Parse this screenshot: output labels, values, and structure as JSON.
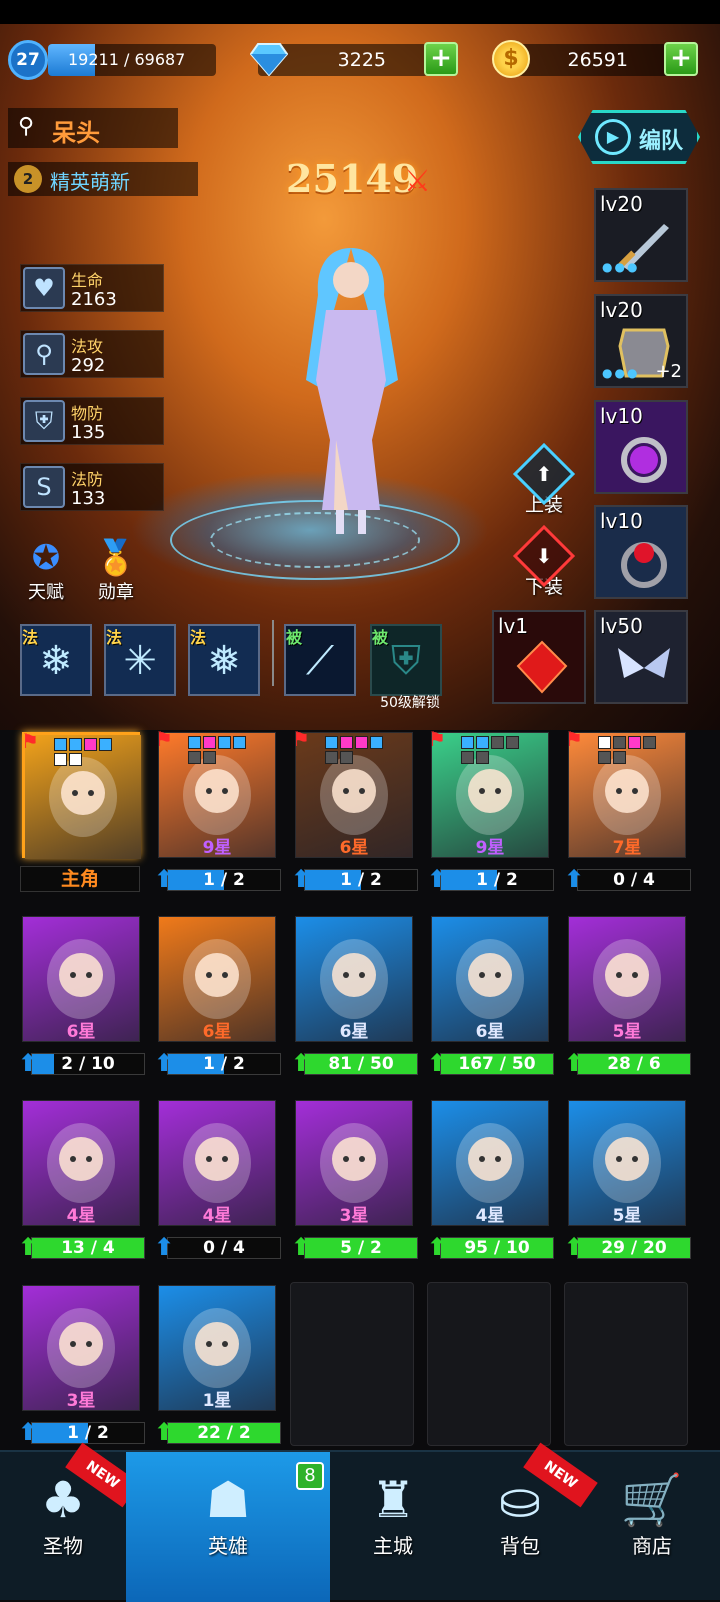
{
  "player": {
    "level": "27",
    "xp": "19211 / 69687",
    "xp_fraction": 0.276,
    "gems": "3225",
    "gold": "26591",
    "name": "呆头",
    "rank": "精英萌新",
    "rank_badge": "2",
    "power": "25149",
    "team_button": "编队"
  },
  "stats": [
    {
      "label": "生命",
      "value": "2163",
      "icon": "heart-icon"
    },
    {
      "label": "法攻",
      "value": "292",
      "icon": "wand-icon"
    },
    {
      "label": "物防",
      "value": "135",
      "icon": "shield-icon"
    },
    {
      "label": "法防",
      "value": "133",
      "icon": "magic-shield-icon"
    }
  ],
  "equipment": [
    {
      "level": "lv20",
      "icon": "sword-icon",
      "dots": "●●●",
      "plus": ""
    },
    {
      "level": "lv20",
      "icon": "armor-icon",
      "dots": "●●●",
      "plus": "+2"
    },
    {
      "level": "lv10",
      "icon": "purple-ring-icon",
      "dots": "",
      "plus": ""
    },
    {
      "level": "lv10",
      "icon": "red-ring-icon",
      "dots": "",
      "plus": ""
    },
    {
      "level": "lv1",
      "icon": "red-gem-icon",
      "dots": "",
      "plus": ""
    },
    {
      "level": "lv50",
      "icon": "wings-icon",
      "dots": "",
      "plus": ""
    }
  ],
  "actions": {
    "equip_on": "上装",
    "equip_off": "下装",
    "talent": "天赋",
    "medal": "勋章"
  },
  "skills": [
    {
      "tag": "法",
      "icon": "ice-crystal-icon"
    },
    {
      "tag": "法",
      "icon": "snowflake-burst-icon"
    },
    {
      "tag": "法",
      "icon": "blizzard-icon"
    },
    {
      "tag": "被",
      "icon": "ice-blade-icon"
    },
    {
      "tag": "被",
      "icon": "locked-shield-icon",
      "lock_text": "50级解锁"
    }
  ],
  "heroes": [
    {
      "star": "",
      "progress": "",
      "main": true,
      "main_label": "主角",
      "bg": "#f2a21a",
      "arrow": "",
      "fill_color": ""
    },
    {
      "star": "9星",
      "progress": "1 / 2",
      "bg": "#ff7a2a",
      "arrow": "blue",
      "fill_color": "#1c8ee8",
      "fill": 0.5
    },
    {
      "star": "6星",
      "progress": "1 / 2",
      "bg": "#6b3a1a",
      "arrow": "blue",
      "fill_color": "#1c8ee8",
      "fill": 0.5
    },
    {
      "star": "9星",
      "progress": "1 / 2",
      "bg": "#3ad08a",
      "arrow": "blue",
      "fill_color": "#1c8ee8",
      "fill": 0.5
    },
    {
      "star": "7星",
      "progress": "0 / 4",
      "bg": "#ff8a3a",
      "arrow": "blue",
      "fill_color": "#1c8ee8",
      "fill": 0.0
    },
    {
      "star": "6星",
      "progress": "2 / 10",
      "bg": "#a32ed8",
      "arrow": "blue",
      "fill_color": "#1c8ee8",
      "fill": 0.2
    },
    {
      "star": "6星",
      "progress": "1 / 2",
      "bg": "#f07a1a",
      "arrow": "blue",
      "fill_color": "#1c8ee8",
      "fill": 0.5
    },
    {
      "star": "6星",
      "progress": "81 / 50",
      "bg": "#1c8ee8",
      "arrow": "green",
      "fill_color": "#2ed82e",
      "fill": 1.0
    },
    {
      "star": "6星",
      "progress": "167 / 50",
      "bg": "#1c8ee8",
      "arrow": "green",
      "fill_color": "#2ed82e",
      "fill": 1.0
    },
    {
      "star": "5星",
      "progress": "28 / 6",
      "bg": "#a32ed8",
      "arrow": "green",
      "fill_color": "#2ed82e",
      "fill": 1.0
    },
    {
      "star": "4星",
      "progress": "13 / 4",
      "bg": "#a32ed8",
      "arrow": "green",
      "fill_color": "#2ed82e",
      "fill": 1.0
    },
    {
      "star": "4星",
      "progress": "0 / 4",
      "bg": "#a32ed8",
      "arrow": "blue",
      "fill_color": "#1c8ee8",
      "fill": 0.0
    },
    {
      "star": "3星",
      "progress": "5 / 2",
      "bg": "#a32ed8",
      "arrow": "green",
      "fill_color": "#2ed82e",
      "fill": 1.0
    },
    {
      "star": "4星",
      "progress": "95 / 10",
      "bg": "#1c8ee8",
      "arrow": "green",
      "fill_color": "#2ed82e",
      "fill": 1.0
    },
    {
      "star": "5星",
      "progress": "29 / 20",
      "bg": "#1c8ee8",
      "arrow": "green",
      "fill_color": "#2ed82e",
      "fill": 1.0
    },
    {
      "star": "3星",
      "progress": "1 / 2",
      "bg": "#a32ed8",
      "arrow": "blue",
      "fill_color": "#1c8ee8",
      "fill": 0.5
    },
    {
      "star": "1星",
      "progress": "22 / 2",
      "bg": "#1c8ee8",
      "arrow": "green",
      "fill_color": "#2ed82e",
      "fill": 1.0
    }
  ],
  "nav": [
    {
      "label": "圣物",
      "icon": "clover-icon",
      "badge": "NEW"
    },
    {
      "label": "英雄",
      "icon": "hero-helmet-icon",
      "count": "8",
      "active": true
    },
    {
      "label": "主城",
      "icon": "castle-icon"
    },
    {
      "label": "背包",
      "icon": "backpack-icon",
      "badge": "NEW"
    },
    {
      "label": "商店",
      "icon": "cart-icon"
    }
  ],
  "colors": {
    "accent": "#1c8ee8",
    "ready": "#2ed82e",
    "gold": "#ffd24a",
    "team": "#29d8c8"
  }
}
